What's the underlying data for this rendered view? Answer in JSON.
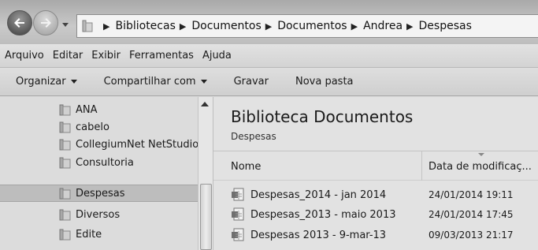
{
  "address_bar": {
    "breadcrumbs": [
      "Bibliotecas",
      "Documentos",
      "Documentos",
      "Andrea",
      "Despesas"
    ],
    "icons": [
      "back-arrow-icon",
      "forward-arrow-icon",
      "folder-library-icon",
      "chevron-right-icon"
    ]
  },
  "menu": {
    "items": [
      "Arquivo",
      "Editar",
      "Exibir",
      "Ferramentas",
      "Ajuda"
    ]
  },
  "toolbar": {
    "organize_label": "Organizar",
    "share_label": "Compartilhar com",
    "burn_label": "Gravar",
    "new_folder_label": "Nova pasta"
  },
  "nav_pane": {
    "items": [
      {
        "label": "ANA",
        "selected": false
      },
      {
        "label": "cabelo",
        "selected": false
      },
      {
        "label": "CollegiumNet  NetStudio",
        "selected": false
      },
      {
        "label": "Consultoria",
        "selected": false
      },
      {
        "label": "Despesas",
        "selected": true
      },
      {
        "label": "Diversos",
        "selected": false
      },
      {
        "label": "Edite",
        "selected": false
      }
    ]
  },
  "content": {
    "library_title": "Biblioteca Documentos",
    "library_subtitle": "Despesas",
    "columns": {
      "name": "Nome",
      "date": "Data de modificaç..."
    },
    "files": [
      {
        "name": "Despesas_2014 - jan 2014",
        "date": "24/01/2014 19:11"
      },
      {
        "name": "Despesas_2013 - maio 2013",
        "date": "24/01/2014 17:45"
      },
      {
        "name": "Despesas 2013 - 9-mar-13",
        "date": "09/03/2013 21:17"
      }
    ]
  },
  "colors": {
    "selected_row": "#bdbdbd",
    "pane_background": "#dcdcdc"
  }
}
